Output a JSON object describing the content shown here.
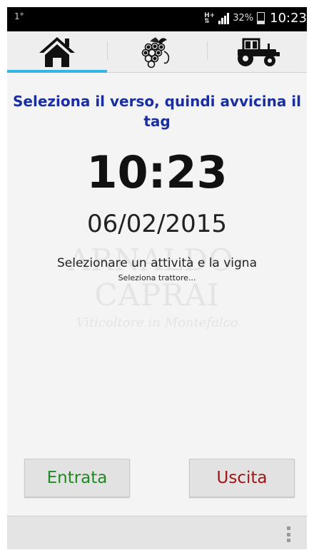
{
  "status_bar": {
    "left_indicator": "1°",
    "network": "H+",
    "battery": "32%",
    "clock": "10:23"
  },
  "tabs": [
    {
      "icon": "home-icon",
      "selected": true
    },
    {
      "icon": "grapes-icon",
      "selected": false
    },
    {
      "icon": "tractor-icon",
      "selected": false
    }
  ],
  "main": {
    "instruction": "Seleziona il verso, quindi avvicina il tag",
    "time": "10:23",
    "date": "06/02/2015",
    "activity_prompt": "Selezionare un attività e la vigna",
    "tractor_prompt": "Seleziona trattore..."
  },
  "watermark": {
    "title": "ARNALDO-CAPRAI",
    "subtitle": "Viticoltore in Montefalco"
  },
  "buttons": {
    "enter_label": "Entrata",
    "exit_label": "Uscita"
  },
  "colors": {
    "accent": "#33b5e5",
    "instruction": "#1a2e9e",
    "enter": "#1f8a1f",
    "exit": "#a01414"
  }
}
